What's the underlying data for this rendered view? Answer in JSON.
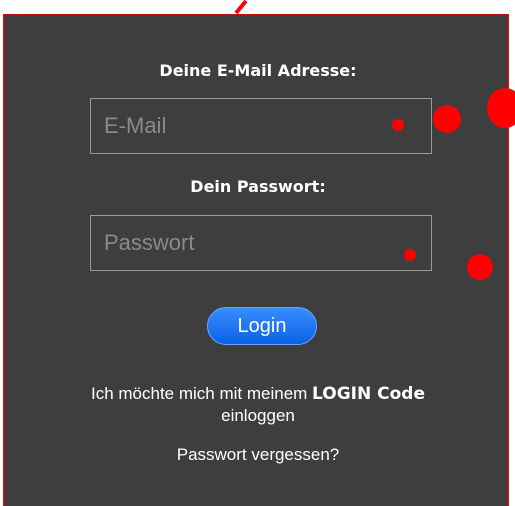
{
  "form": {
    "email_label": "Deine E-Mail Adresse:",
    "email_placeholder": "E-Mail",
    "email_value": "",
    "password_label": "Dein Passwort:",
    "password_placeholder": "Passwort",
    "password_value": "",
    "login_button_label": "Login"
  },
  "alt_login": {
    "prefix": "Ich möchte mich mit meinem",
    "highlight": "LOGIN Code",
    "suffix": "einloggen"
  },
  "forgot_password_label": "Passwort vergessen?",
  "colors": {
    "panel_background": "#3e3e3e",
    "panel_border": "#b51414",
    "annotation_red": "#ff0000",
    "button_blue": "#1a72f0",
    "text": "#ffffff"
  }
}
